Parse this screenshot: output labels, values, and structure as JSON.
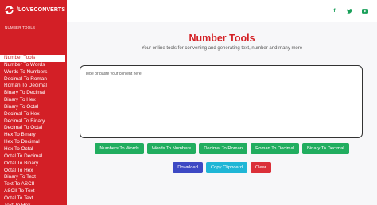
{
  "brand": {
    "name": "/LOVECONVERTS"
  },
  "sidebar": {
    "section_label": "NUMBER TOOLS",
    "items": [
      {
        "label": "Number Tools",
        "active": true
      },
      {
        "label": "Number To Words"
      },
      {
        "label": "Words To Numbers"
      },
      {
        "label": "Decimal To Roman"
      },
      {
        "label": "Roman To Decimal"
      },
      {
        "label": "Binary To Decimal"
      },
      {
        "label": "Binary To Hex"
      },
      {
        "label": "Binary To Octal"
      },
      {
        "label": "Decimal To Hex"
      },
      {
        "label": "Decimal To Binary"
      },
      {
        "label": "Decimal To Octal"
      },
      {
        "label": "Hex To Binary"
      },
      {
        "label": "Hex To Decimal"
      },
      {
        "label": "Hex To Octal"
      },
      {
        "label": "Octal To Decimal"
      },
      {
        "label": "Octal To Binary"
      },
      {
        "label": "Octal To Hex"
      },
      {
        "label": "Binary To Text"
      },
      {
        "label": "Text To ASCII"
      },
      {
        "label": "ASCII To Text"
      },
      {
        "label": "Octal To Text"
      },
      {
        "label": "Text To Hex"
      }
    ]
  },
  "social": {
    "facebook_icon": "f",
    "twitter_icon": "t",
    "youtube_icon": "youtube"
  },
  "main": {
    "title": "Number Tools",
    "subtitle": "Your online tools for converting and generating text, number and many more",
    "input_placeholder": "Type or paste your content here",
    "convert_buttons": [
      "Numbers To Words",
      "Words To Numbers",
      "Decimal To Roman",
      "Roman To Decimal",
      "Binary To Decimal"
    ],
    "actions": {
      "download": "Download",
      "copy": "Copy Clipboard",
      "clear": "Clear"
    }
  },
  "colors": {
    "brand_red": "#d31f26",
    "green": "#21ad5f",
    "blue": "#3d49c4",
    "teal": "#1fb6d6",
    "clear_red": "#db3039"
  }
}
